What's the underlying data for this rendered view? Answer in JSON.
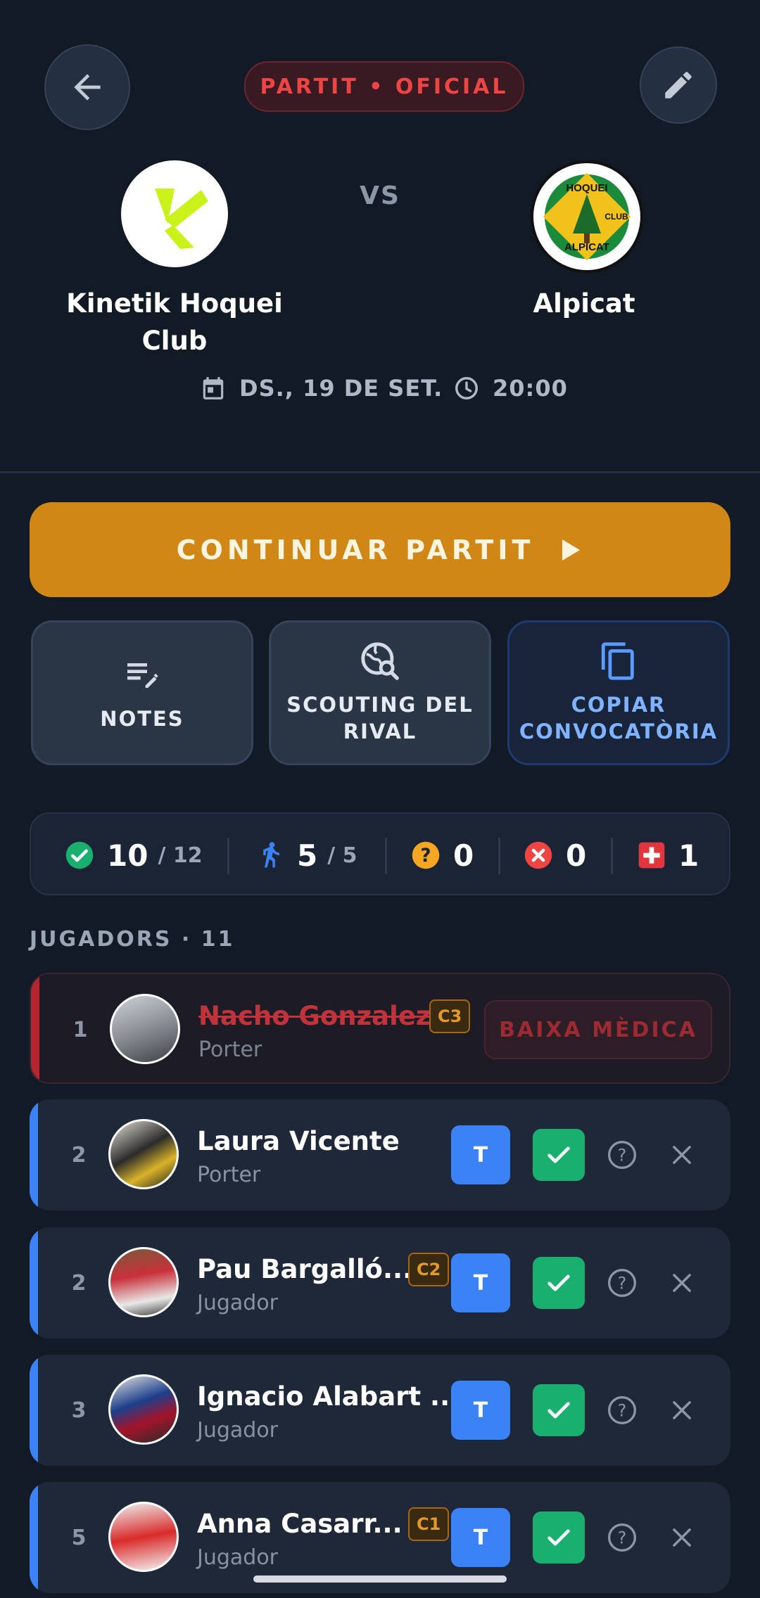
{
  "header": {
    "match_type": "PARTIT • OFICIAL",
    "vs_label": "VS",
    "home_team": {
      "name": "Kinetik Hoquei Club"
    },
    "away_team": {
      "name": "Alpicat",
      "logo_text": [
        "HOQUEI",
        "CLUB",
        "ALPICAT"
      ]
    },
    "date": "DS., 19 DE SET.",
    "time": "20:00"
  },
  "primary_action": {
    "label": "CONTINUAR PARTIT"
  },
  "actions": [
    {
      "label": "NOTES",
      "icon": "notes-edit-icon"
    },
    {
      "label": "SCOUTING DEL RIVAL",
      "icon": "globe-search-icon"
    },
    {
      "label": "COPIAR CONVOCATÒRIA",
      "icon": "copy-icon"
    }
  ],
  "stats": {
    "confirmed": "10",
    "confirmed_total": "/ 12",
    "players_in_field": "5",
    "players_in_field_total": "/ 5",
    "unknown": "0",
    "declined": "0",
    "injured": "1"
  },
  "section": {
    "label": "JUGADORS · 11"
  },
  "players": [
    {
      "number": "1",
      "name": "Nacho Gonzalez",
      "role": "Porter",
      "badge": "C3",
      "status": "BAIXA MÈDICA"
    },
    {
      "number": "2",
      "name": "Laura Vicente",
      "role": "Porter",
      "starter": "T"
    },
    {
      "number": "2",
      "name": "Pau Bargalló...",
      "role": "Jugador",
      "badge": "C2",
      "starter": "T"
    },
    {
      "number": "3",
      "name": "Ignacio Alabart ...",
      "role": "Jugador",
      "starter": "T"
    },
    {
      "number": "5",
      "name": "Anna Casarr...",
      "role": "Jugador",
      "badge": "C1",
      "starter": "T"
    }
  ],
  "colors": {
    "background": "#111a25",
    "accent_orange": "#d08716",
    "accent_blue": "#3b82f6",
    "success_green": "#19b06f",
    "danger_red": "#ef4444",
    "warning_yellow": "#f5a623"
  }
}
